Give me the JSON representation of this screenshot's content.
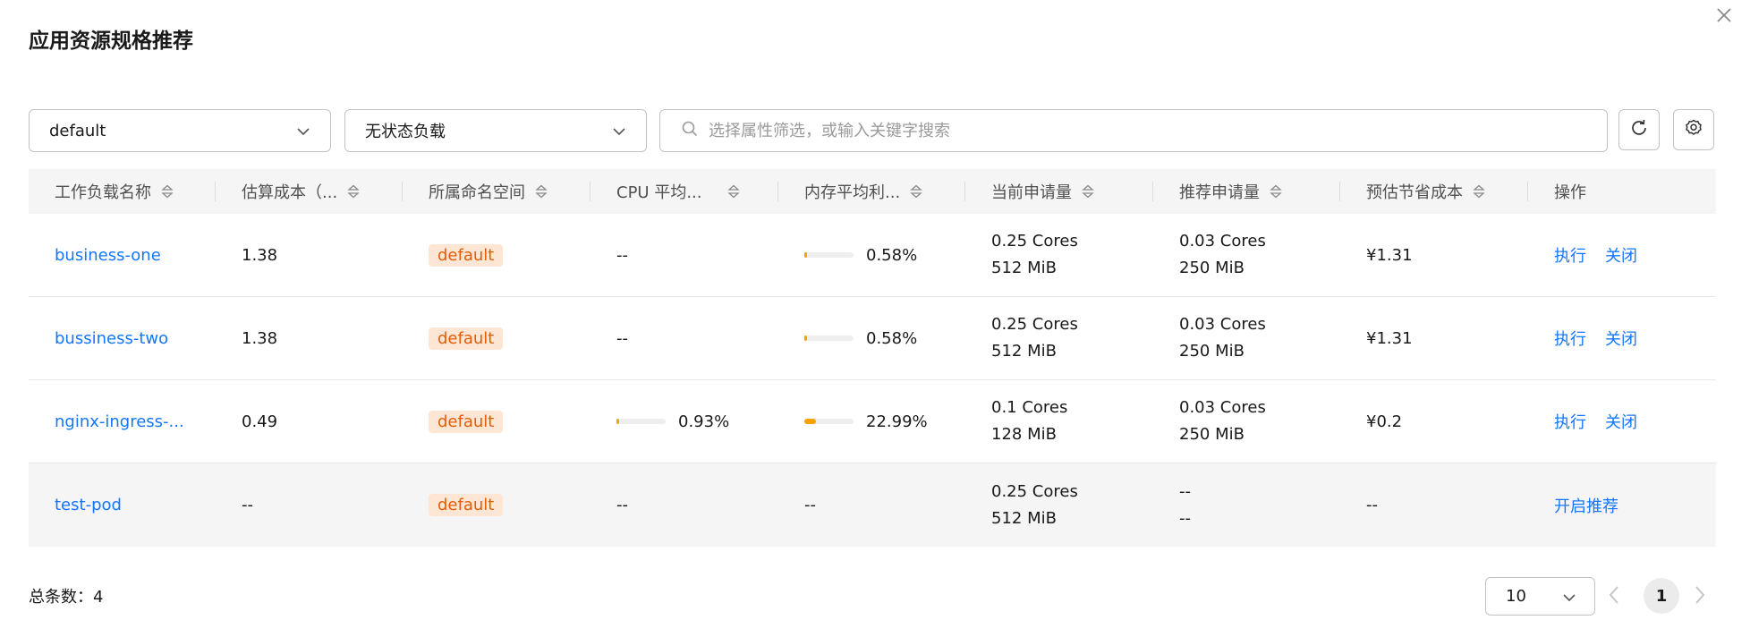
{
  "dialog": {
    "title": "应用资源规格推荐"
  },
  "filters": {
    "namespace": "default",
    "workload_kind": "无状态负载",
    "search_placeholder": "选择属性筛选，或输入关键字搜索"
  },
  "table": {
    "headers": [
      "工作负载名称",
      "估算成本（...",
      "所属命名空间",
      "CPU 平均...",
      "内存平均利...",
      "当前申请量",
      "推荐申请量",
      "预估节省成本",
      "操作"
    ],
    "rows": [
      {
        "name": "business-one",
        "cost": "1.38",
        "namespace": "default",
        "cpu": {
          "text": "--",
          "bar": null
        },
        "mem": {
          "text": "0.58%",
          "bar": 0.0058
        },
        "current_cpu": "0.25 Cores",
        "current_mem": "512 MiB",
        "rec_cpu": "0.03 Cores",
        "rec_mem": "250 MiB",
        "saving": "¥1.31",
        "actions": [
          "执行",
          "关闭"
        ]
      },
      {
        "name": "bussiness-two",
        "cost": "1.38",
        "namespace": "default",
        "cpu": {
          "text": "--",
          "bar": null
        },
        "mem": {
          "text": "0.58%",
          "bar": 0.0058
        },
        "current_cpu": "0.25 Cores",
        "current_mem": "512 MiB",
        "rec_cpu": "0.03 Cores",
        "rec_mem": "250 MiB",
        "saving": "¥1.31",
        "actions": [
          "执行",
          "关闭"
        ]
      },
      {
        "name": "nginx-ingress-...",
        "cost": "0.49",
        "namespace": "default",
        "cpu": {
          "text": "0.93%",
          "bar": 0.0093
        },
        "mem": {
          "text": "22.99%",
          "bar": 0.2299
        },
        "current_cpu": "0.1 Cores",
        "current_mem": "128 MiB",
        "rec_cpu": "0.03 Cores",
        "rec_mem": "250 MiB",
        "saving": "¥0.2",
        "actions": [
          "执行",
          "关闭"
        ]
      },
      {
        "name": "test-pod",
        "cost": "--",
        "namespace": "default",
        "cpu": {
          "text": "--",
          "bar": null
        },
        "mem": {
          "text": "--",
          "bar": null
        },
        "current_cpu": "0.25 Cores",
        "current_mem": "512 MiB",
        "rec_cpu": "--",
        "rec_mem": "--",
        "saving": "--",
        "actions": [
          "开启推荐"
        ]
      }
    ]
  },
  "footer": {
    "total_label": "总条数：4",
    "page_size": "10",
    "current_page": "1"
  },
  "colors": {
    "link": "#1476ff",
    "tag_bg": "#fde6d4",
    "tag_text": "#e35d06",
    "bar_fill": "#f6a300"
  }
}
